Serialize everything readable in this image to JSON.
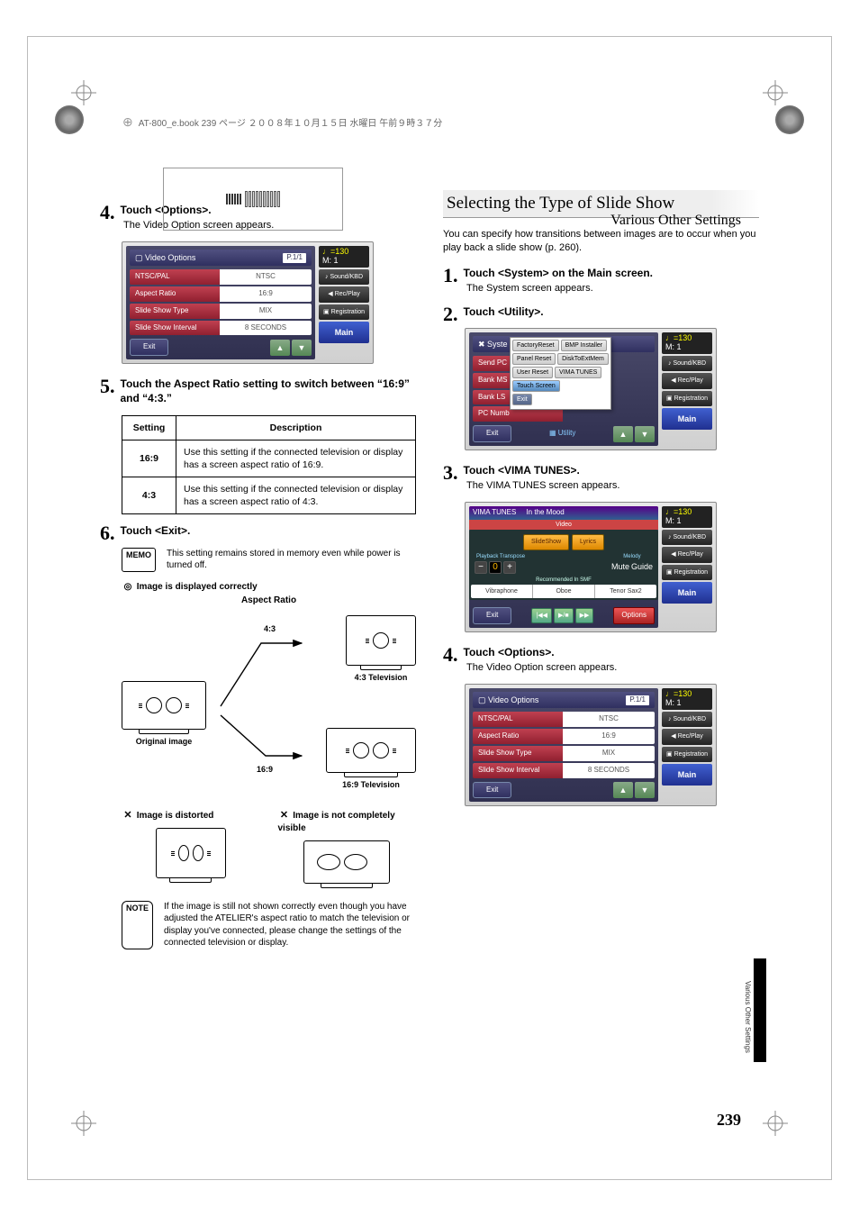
{
  "meta": {
    "headerText": "AT-800_e.book 239 ページ ２００８年１０月１５日 水曜日 午前９時３７分",
    "chapterTitle": "Various Other Settings",
    "pageNumber": "239",
    "sideTabText": "Various Other Settings"
  },
  "left": {
    "step4": {
      "num": "4",
      "title": "Touch <Options>.",
      "sub": "The Video Option screen appears."
    },
    "step5": {
      "num": "5",
      "title": "Touch the Aspect Ratio setting to switch between “16:9” and “4:3.”"
    },
    "step6": {
      "num": "6",
      "title": "Touch <Exit>."
    },
    "memoText": "This setting remains stored in memory even while power is turned off.",
    "noteText": "If the image is still not shown correctly even though you have adjusted the ATELIER's aspect ratio to match the television or display you've connected, please change the settings of the connected television or display.",
    "aspectTable": {
      "headers": {
        "setting": "Setting",
        "desc": "Description"
      },
      "rows": [
        {
          "setting": "16:9",
          "desc": "Use this setting if the connected television or display has a screen aspect ratio of 16:9."
        },
        {
          "setting": "4:3",
          "desc": "Use this setting if the connected television or display has a screen aspect ratio of 4:3."
        }
      ]
    },
    "diagram": {
      "correct": "Image is displayed correctly",
      "aspectRatio": "Aspect Ratio",
      "r43": "4:3",
      "r169": "16:9",
      "original": "Original image",
      "tv43": "4:3 Television",
      "tv169": "16:9 Television",
      "distorted": "Image is distorted",
      "notVisible": "Image is not completely visible"
    }
  },
  "right": {
    "sectionTitle": "Selecting the Type of Slide Show",
    "intro": "You can specify how transitions between images are to occur when you play back a slide show (p. 260).",
    "step1": {
      "num": "1",
      "title": "Touch <System> on the Main screen.",
      "sub": "The System screen appears."
    },
    "step2": {
      "num": "2",
      "title": "Touch <Utility>."
    },
    "step3": {
      "num": "3",
      "title": "Touch <VIMA TUNES>.",
      "sub": "The VIMA TUNES screen appears."
    },
    "step4": {
      "num": "4",
      "title": "Touch <Options>.",
      "sub": "The Video Option screen appears."
    }
  },
  "ui": {
    "videoOptions": {
      "title": "Video Options",
      "page": "P.1/1",
      "rows": [
        {
          "label": "NTSC/PAL",
          "value": "NTSC"
        },
        {
          "label": "Aspect Ratio",
          "value": "16:9"
        },
        {
          "label": "Slide Show Type",
          "value": "MIX"
        },
        {
          "label": "Slide Show Interval",
          "value": "8 SECONDS"
        }
      ],
      "exit": "Exit"
    },
    "sidebar": {
      "tempo": "♩=130",
      "measure": "M:    1",
      "soundKbd": "Sound/KBD",
      "recPlay": "Rec/Play",
      "registration": "Registration",
      "main": "Main"
    },
    "system": {
      "title": "Syste",
      "rows": [
        "Send PC",
        "Bank MS",
        "Bank LS",
        "PC Numb"
      ],
      "exit": "Exit",
      "utility": "Utility",
      "popup": [
        [
          "FactoryReset",
          "BMP Installer"
        ],
        [
          "Panel Reset",
          "DiskToExtMem"
        ],
        [
          "User Reset",
          "VIMA TUNES"
        ],
        [
          "Touch Screen",
          null
        ]
      ]
    },
    "vima": {
      "title": "VIMA TUNES",
      "song": "In the Mood",
      "videoTab": "Video",
      "slideShow": "SlideShow",
      "lyrics": "Lyrics",
      "playbackTranspose": "Playback Transpose",
      "transposeValue": "0",
      "melody": "Melody",
      "mute": "Mute",
      "guide": "Guide",
      "recommended": "Recommended In SMF",
      "instruments": [
        "Vibraphone",
        "Oboe",
        "Tenor Sax2"
      ],
      "exit": "Exit",
      "options": "Options"
    },
    "labels": {
      "memo": "MEMO",
      "note": "NOTE"
    }
  }
}
